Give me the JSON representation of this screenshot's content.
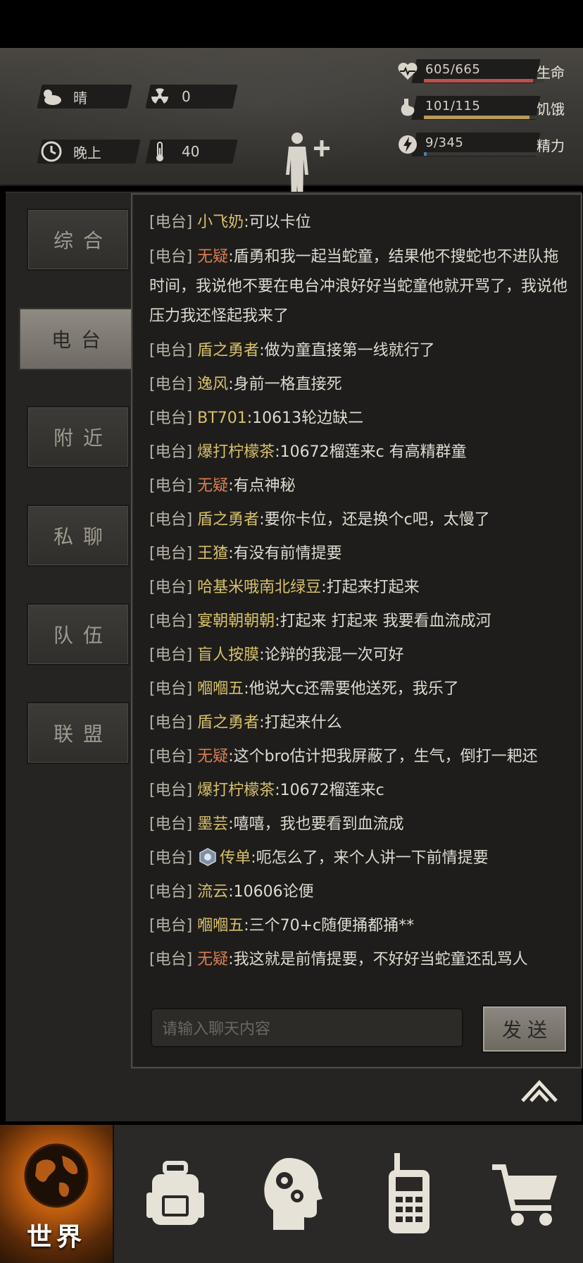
{
  "status": {
    "weather": "晴",
    "radiation": "0",
    "time_of_day": "晚上",
    "temperature": "40"
  },
  "vitals": {
    "health": {
      "value": "605/665",
      "label": "生命",
      "fraction": 0.91,
      "color": "#c0504a"
    },
    "hunger": {
      "value": "101/115",
      "label": "饥饿",
      "fraction": 0.88,
      "color": "#b89a5c"
    },
    "energy": {
      "value": "9/345",
      "label": "精力",
      "fraction": 0.026,
      "color": "#4a7ec0"
    }
  },
  "tabs": [
    {
      "label": "综合",
      "active": false
    },
    {
      "label": "电台",
      "active": true
    },
    {
      "label": "附近",
      "active": false
    },
    {
      "label": "私聊",
      "active": false
    },
    {
      "label": "队伍",
      "active": false
    },
    {
      "label": "联盟",
      "active": false
    }
  ],
  "messages": [
    {
      "channel": "[电台]",
      "nick": "小飞奶",
      "nick_color": "yellow",
      "text": ":可以卡位"
    },
    {
      "channel": "[电台]",
      "nick": "无疑",
      "nick_color": "red",
      "text": ":盾勇和我一起当蛇童，结果他不搜蛇也不进队拖时间，我说他不要在电台冲浪好好当蛇童他就开骂了，我说他压力我还怪起我来了"
    },
    {
      "channel": "[电台]",
      "nick": "盾之勇者",
      "nick_color": "yellow",
      "text": ":做为童直接第一线就行了"
    },
    {
      "channel": "[电台]",
      "nick": "逸风",
      "nick_color": "yellow",
      "text": ":身前一格直接死"
    },
    {
      "channel": "[电台]",
      "nick": "BT701",
      "nick_color": "yellow",
      "text": ":10613轮边缺二"
    },
    {
      "channel": "[电台]",
      "nick": "爆打柠檬茶",
      "nick_color": "yellow",
      "text": ":10672榴莲来c 有高精群童"
    },
    {
      "channel": "[电台]",
      "nick": "无疑",
      "nick_color": "red",
      "text": ":有点神秘"
    },
    {
      "channel": "[电台]",
      "nick": "盾之勇者",
      "nick_color": "yellow",
      "text": ":要你卡位，还是换个c吧，太慢了"
    },
    {
      "channel": "[电台]",
      "nick": "王猹",
      "nick_color": "yellow",
      "text": ":有没有前情提要"
    },
    {
      "channel": "[电台]",
      "nick": "哈基米哦南北绿豆",
      "nick_color": "yellow",
      "text": ":打起来打起来"
    },
    {
      "channel": "[电台]",
      "nick": "宴朝朝朝朝",
      "nick_color": "yellow",
      "text": ":打起来 打起来 我要看血流成河"
    },
    {
      "channel": "[电台]",
      "nick": "盲人按膜",
      "nick_color": "yellow",
      "text": ":论辩的我混一次可好"
    },
    {
      "channel": "[电台]",
      "nick": "嗰嗰五",
      "nick_color": "yellow",
      "text": ":他说大c还需要他送死，我乐了"
    },
    {
      "channel": "[电台]",
      "nick": "盾之勇者",
      "nick_color": "yellow",
      "text": ":打起来什么"
    },
    {
      "channel": "[电台]",
      "nick": "无疑",
      "nick_color": "red",
      "text": ":这个bro估计把我屏蔽了，生气，倒打一耙还"
    },
    {
      "channel": "[电台]",
      "nick": "爆打柠檬茶",
      "nick_color": "yellow",
      "text": ":10672榴莲来c"
    },
    {
      "channel": "[电台]",
      "nick": "墨芸",
      "nick_color": "yellow",
      "text": ":嘻嘻，我也要看到血流成"
    },
    {
      "channel": "[电台]",
      "nick": "传单",
      "nick_color": "yellow",
      "text": ":呃怎么了，来个人讲一下前情提要",
      "badge": true
    },
    {
      "channel": "[电台]",
      "nick": "流云",
      "nick_color": "yellow",
      "text": ":10606论便"
    },
    {
      "channel": "[电台]",
      "nick": "嗰嗰五",
      "nick_color": "yellow",
      "text": ":三个70+c随便捅都捅**"
    },
    {
      "channel": "[电台]",
      "nick": "无疑",
      "nick_color": "red",
      "text": ":我这就是前情提要，不好好当蛇童还乱骂人"
    }
  ],
  "input": {
    "placeholder": "请输入聊天内容"
  },
  "send_label": "发送",
  "bottom_nav": {
    "world_label": "世界"
  }
}
